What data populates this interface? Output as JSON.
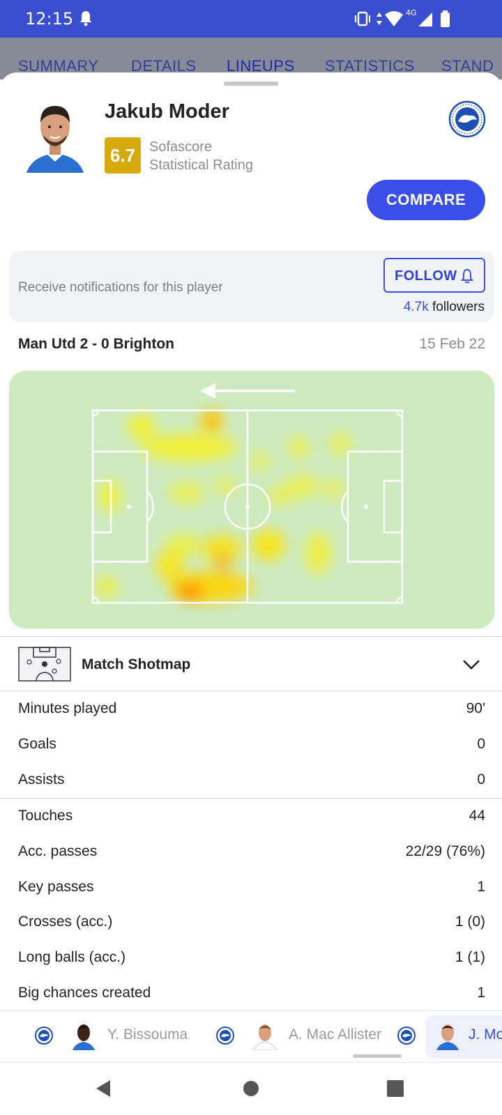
{
  "status_bar": {
    "time": "12:15",
    "network": "4G"
  },
  "tabs": [
    {
      "label": "SUMMARY"
    },
    {
      "label": "DETAILS"
    },
    {
      "label": "LINEUPS"
    },
    {
      "label": "STATISTICS"
    },
    {
      "label": "STAND"
    }
  ],
  "player": {
    "name": "Jakub Moder",
    "rating": "6.7",
    "rating_label_1": "Sofascore",
    "rating_label_2": "Statistical Rating",
    "rating_color": "#d6a90c"
  },
  "compare_label": "COMPARE",
  "notifications": {
    "text": "Receive notifications for this player",
    "follow_label": "FOLLOW",
    "followers_count": "4.7k",
    "followers_label": "followers"
  },
  "match": {
    "title": "Man Utd 2 - 0 Brighton",
    "date": "15 Feb 22"
  },
  "shotmap": {
    "label": "Match Shotmap"
  },
  "stats_group_1": [
    {
      "label": "Minutes played",
      "value": "90'"
    },
    {
      "label": "Goals",
      "value": "0"
    },
    {
      "label": "Assists",
      "value": "0"
    }
  ],
  "stats_group_2": [
    {
      "label": "Touches",
      "value": "44"
    },
    {
      "label": "Acc. passes",
      "value": "22/29 (76%)"
    },
    {
      "label": "Key passes",
      "value": "1"
    },
    {
      "label": "Crosses (acc.)",
      "value": "1 (0)"
    },
    {
      "label": "Long balls (acc.)",
      "value": "1 (1)"
    },
    {
      "label": "Big chances created",
      "value": "1"
    }
  ],
  "player_strip": [
    {
      "name": "Y. Bissouma"
    },
    {
      "name": "A. Mac Allister"
    },
    {
      "name": "J. Moder"
    }
  ],
  "colors": {
    "accent": "#3a4ee8",
    "status_bar": "#3a4ed0",
    "pitch": "#cdeac1"
  }
}
